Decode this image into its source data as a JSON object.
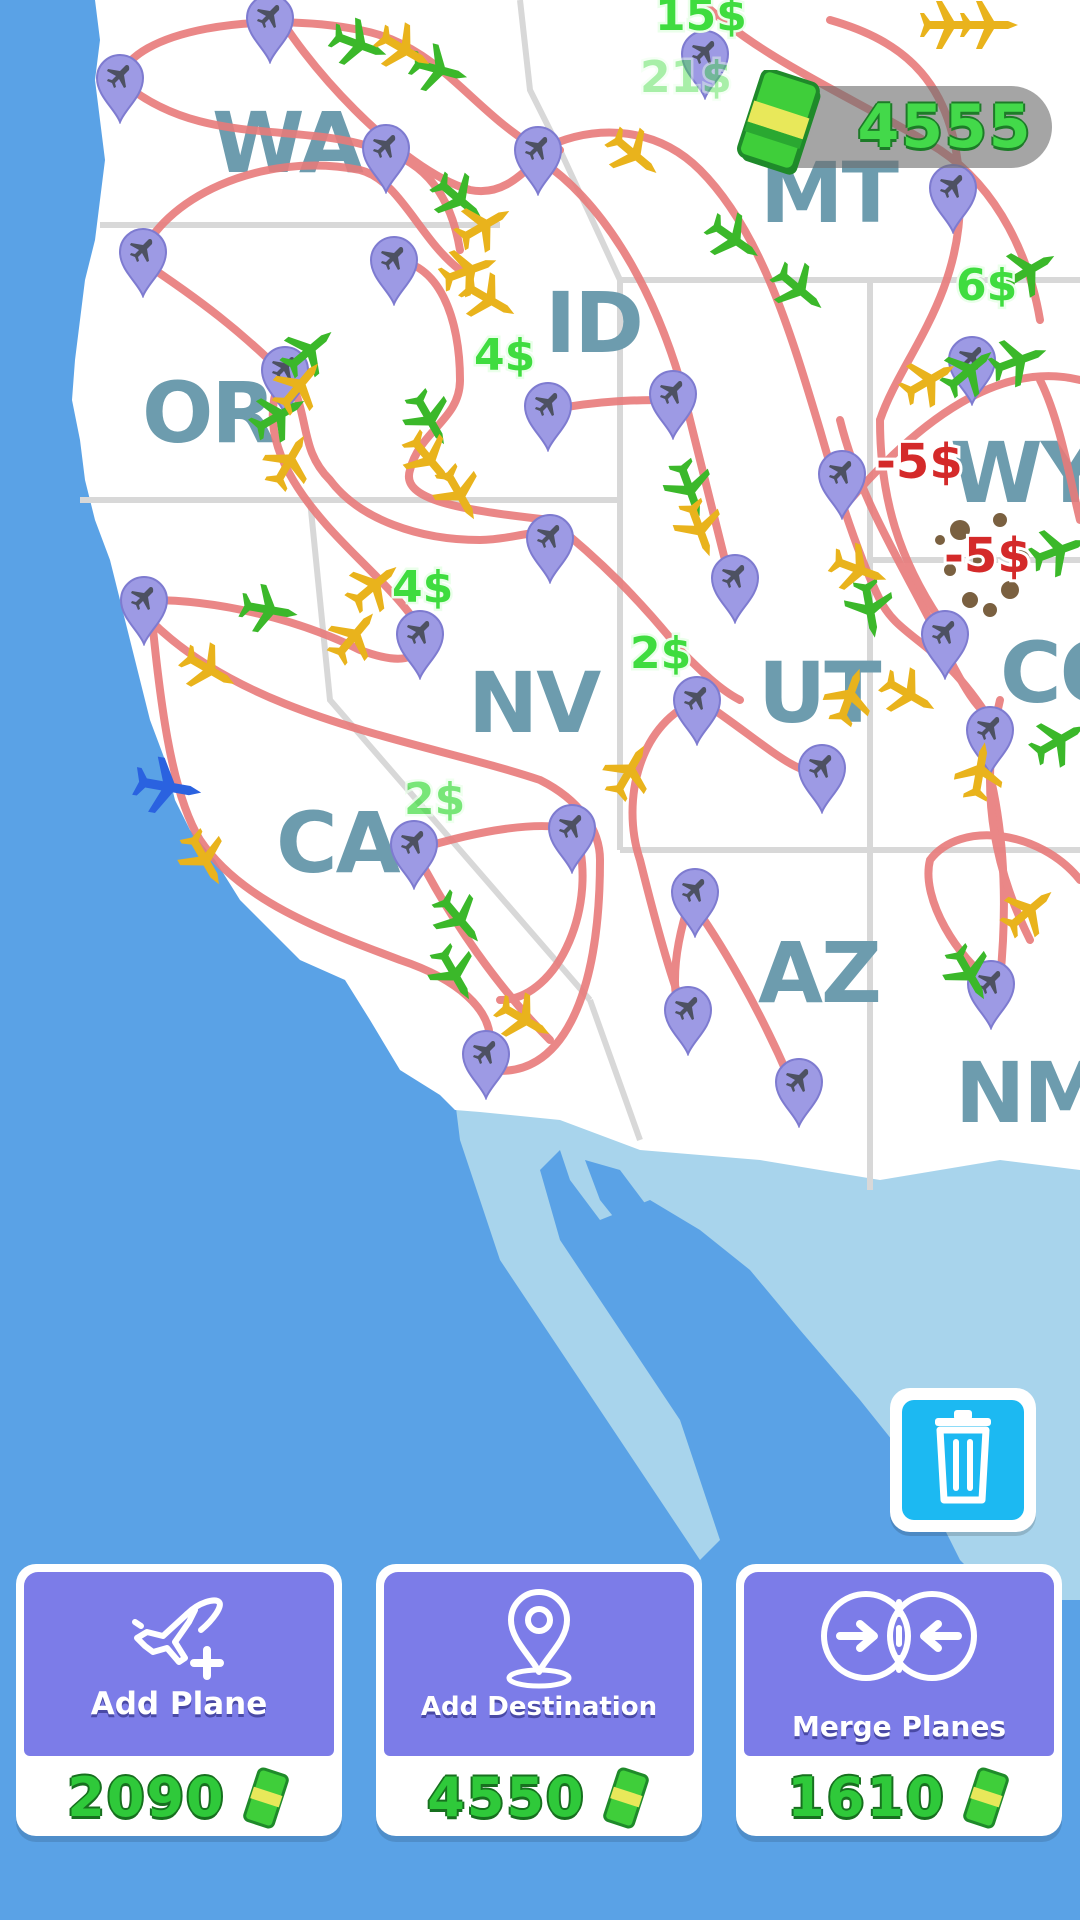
{
  "hud": {
    "money": "4555",
    "money_icon": "cash-stack-icon",
    "money_color": "#43d94a"
  },
  "map": {
    "ocean_color": "#5aa2e6",
    "land_color": "#ffffff",
    "mexico_color": "#a8d4ec",
    "route_color": "#e87b7b",
    "marker_color": "#9d9ae4",
    "state_labels": {
      "wa": "WA",
      "or": "OR",
      "id": "ID",
      "mt": "MT",
      "wy": "WY",
      "nv": "NV",
      "ut": "UT",
      "co": "CO",
      "ca": "CA",
      "az": "AZ",
      "nm": "NM"
    }
  },
  "floating_texts": {
    "t1": "15$",
    "t2": "21$",
    "t3": "4$",
    "t4": "6$",
    "t5": "-5$",
    "t6": "-5$",
    "t7": "4$",
    "t8": "2$",
    "t9": "2$"
  },
  "actions": {
    "trash_icon": "trash-icon",
    "add_plane": {
      "label": "Add Plane",
      "price": "2090",
      "icon": "plane-plus-icon"
    },
    "add_destination": {
      "label": "Add Destination",
      "price": "4550",
      "icon": "location-pin-icon"
    },
    "merge_planes": {
      "label": "Merge Planes",
      "price": "1610",
      "icon": "merge-icon"
    }
  }
}
